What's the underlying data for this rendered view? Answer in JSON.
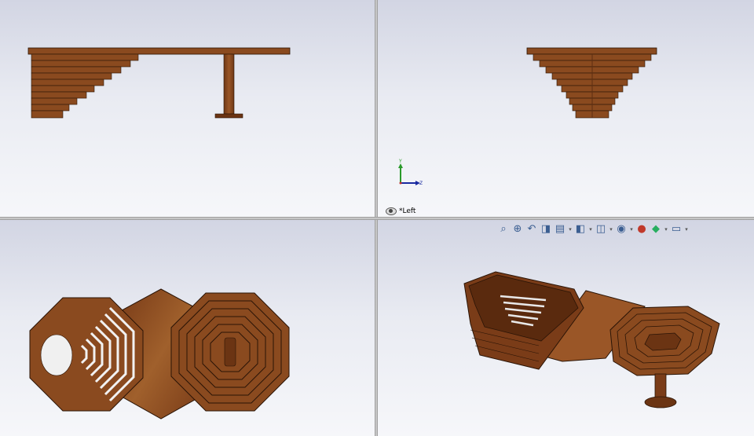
{
  "window": {
    "title": ""
  },
  "viewports": {
    "top_left": {
      "name": ""
    },
    "top_right": {
      "name": "*Left",
      "triad": {
        "y": "Y",
        "z": "Z"
      }
    },
    "bottom_left": {
      "name": ""
    },
    "bottom_right": {
      "name": ""
    }
  },
  "heads_up_toolbar": {
    "icons": [
      "zoom-to-fit-icon",
      "zoom-to-area-icon",
      "previous-view-icon",
      "section-view-icon",
      "dynamic-annotation-icon",
      "view-orientation-icon",
      "display-style-icon",
      "hide-show-items-icon",
      "edit-appearance-icon",
      "apply-scene-icon",
      "view-settings-icon"
    ]
  },
  "colors": {
    "wood": "#8a4a1f",
    "wood_dark": "#5e2e10",
    "wood_light": "#a0602c",
    "edge": "#2a1406",
    "background_top": "#d2d5e3",
    "background_bottom": "#f6f7fa"
  }
}
